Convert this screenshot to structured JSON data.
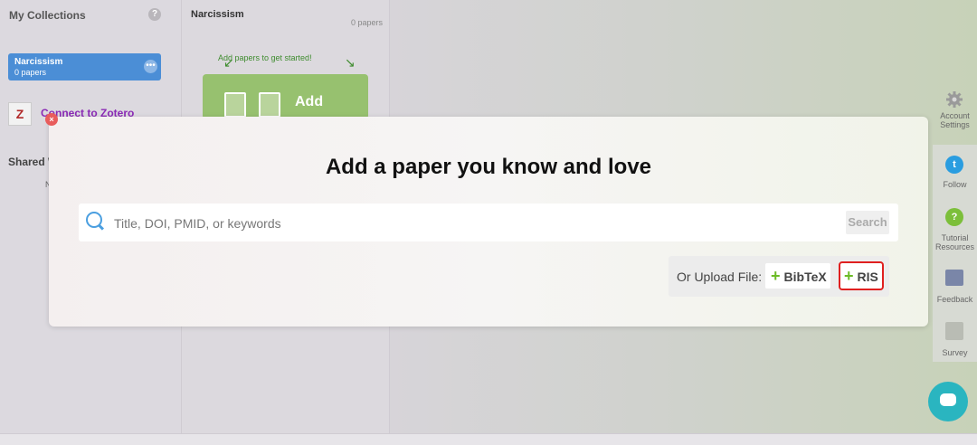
{
  "sidebar": {
    "title": "My Collections",
    "help_icon": "?",
    "collection": {
      "name": "Narcissism",
      "count": "0 papers",
      "menu_glyph": "•••"
    },
    "zotero": {
      "icon": "Z",
      "label": "Connect to Zotero"
    },
    "shared_label": "Shared W",
    "shared_sub": "N"
  },
  "middle": {
    "title": "Narcissism",
    "count": "0 papers",
    "hint": "Add papers to get started!",
    "add_label": "Add",
    "arrow_left": "↙",
    "arrow_right": "↘"
  },
  "right": {
    "account_label": "Account\nSettings",
    "follow_label": "Follow",
    "tutorial_label": "Tutorial\nResources",
    "feedback_label": "Feedback",
    "survey_label": "Survey"
  },
  "modal": {
    "title": "Add a paper you know and love",
    "close_glyph": "×",
    "search": {
      "placeholder": "Title, DOI, PMID, or keywords",
      "button_label": "Search"
    },
    "upload": {
      "label": "Or Upload File:",
      "bibtex_label": "BibTeX",
      "ris_label": "RIS"
    }
  },
  "colors": {
    "accent_blue": "#4b8ed6",
    "green": "#6cbb26",
    "highlight": "#e02020"
  }
}
